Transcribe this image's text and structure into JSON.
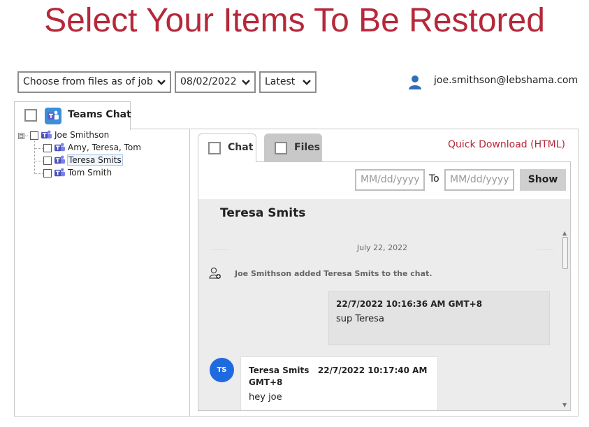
{
  "page": {
    "title": "Select Your Items To Be Restored"
  },
  "filters": {
    "job_select": "Choose from files as of job",
    "date_select": "08/02/2022",
    "version_select": "Latest"
  },
  "user": {
    "email": "joe.smithson@lebshama.com",
    "icon": "user-icon"
  },
  "top_tab": {
    "label": "Teams Chat",
    "icon": "teams-icon"
  },
  "tree": {
    "root": {
      "label": "Joe Smithson",
      "expander": "⊟"
    },
    "children": [
      {
        "label": "Amy, Teresa, Tom"
      },
      {
        "label": "Teresa Smits",
        "selected": true
      },
      {
        "label": "Tom Smith"
      }
    ]
  },
  "tabs": {
    "chat": "Chat",
    "files": "Files"
  },
  "quick_download": "Quick Download (HTML)",
  "date_range": {
    "from_placeholder": "MM/dd/yyyy",
    "to_label": "To",
    "to_placeholder": "MM/dd/yyyy",
    "show_label": "Show"
  },
  "chat": {
    "name": "Teresa Smits",
    "date_separator": "July 22, 2022",
    "system_message": "Joe Smithson added Teresa Smits to the chat.",
    "messages": [
      {
        "meta": "22/7/2022 10:16:36 AM GMT+8",
        "text": "sup Teresa"
      },
      {
        "sender": "Teresa Smits",
        "time": "22/7/2022 10:17:40 AM GMT+8",
        "text": "hey joe",
        "initials": "TS"
      }
    ]
  },
  "colors": {
    "accent": "#b5283a",
    "avatar": "#1f6ae0",
    "teams": "#3b8fd8"
  }
}
